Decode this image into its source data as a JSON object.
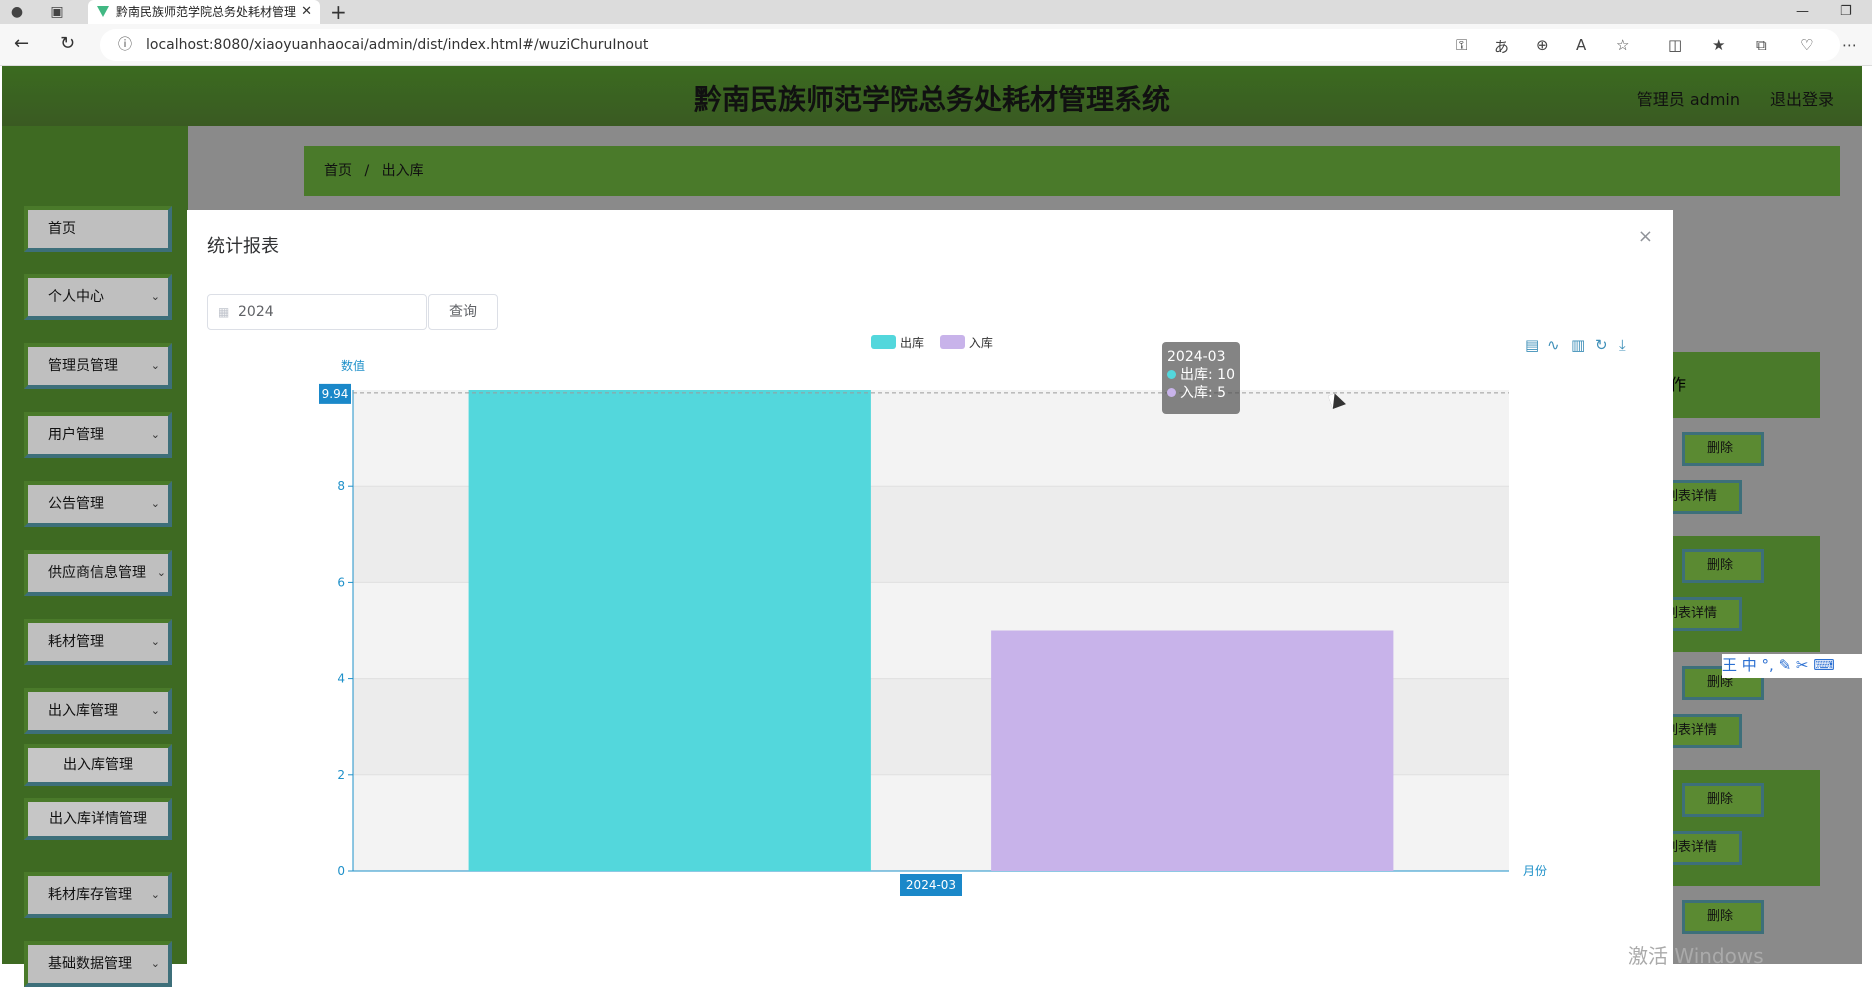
{
  "browser": {
    "tab_title": "黔南民族师范学院总务处耗材管理",
    "url": "localhost:8080/xiaoyuanhaocai/admin/dist/index.html#/wuziChuruInout"
  },
  "app": {
    "title": "黔南民族师范学院总务处耗材管理系统",
    "user_label": "管理员 admin",
    "logout_label": "退出登录",
    "breadcrumb": {
      "home": "首页",
      "sep": "/",
      "current": "出入库"
    }
  },
  "sidebar": {
    "items": [
      {
        "label": "首页"
      },
      {
        "label": "个人中心"
      },
      {
        "label": "管理员管理"
      },
      {
        "label": "用户管理"
      },
      {
        "label": "公告管理"
      },
      {
        "label": "供应商信息管理"
      },
      {
        "label": "耗材管理"
      },
      {
        "label": "出入库管理"
      },
      {
        "label": "耗材库存管理"
      },
      {
        "label": "基础数据管理"
      }
    ],
    "sub_items": [
      {
        "label": "出入库管理"
      },
      {
        "label": "出入库详情管理"
      }
    ]
  },
  "background": {
    "col_header": "作",
    "delete_label": "删除",
    "detail_label": "列表详情"
  },
  "dialog": {
    "title": "统计报表",
    "close": "×",
    "date_value": "2024",
    "query_label": "查询"
  },
  "chart_data": {
    "type": "bar",
    "categories": [
      "2024-03"
    ],
    "series": [
      {
        "name": "出库",
        "values": [
          10
        ],
        "color": "#53d7dc"
      },
      {
        "name": "入库",
        "values": [
          5
        ],
        "color": "#c8b3ea"
      }
    ],
    "ylabel": "数值",
    "xlabel": "月份",
    "ylim": [
      0,
      10
    ],
    "yticks": [
      0,
      2,
      4,
      6,
      8
    ],
    "pointer_value": "9.94",
    "x_pointer_label": "2024-03",
    "legend_position": "top-center"
  },
  "tooltip": {
    "title": "2024-03",
    "line1": "出库: 10",
    "line2": "入库: 5"
  },
  "ime": "王 中 °, ✎ ✂ ⌨",
  "watermark": "激活 Windows"
}
